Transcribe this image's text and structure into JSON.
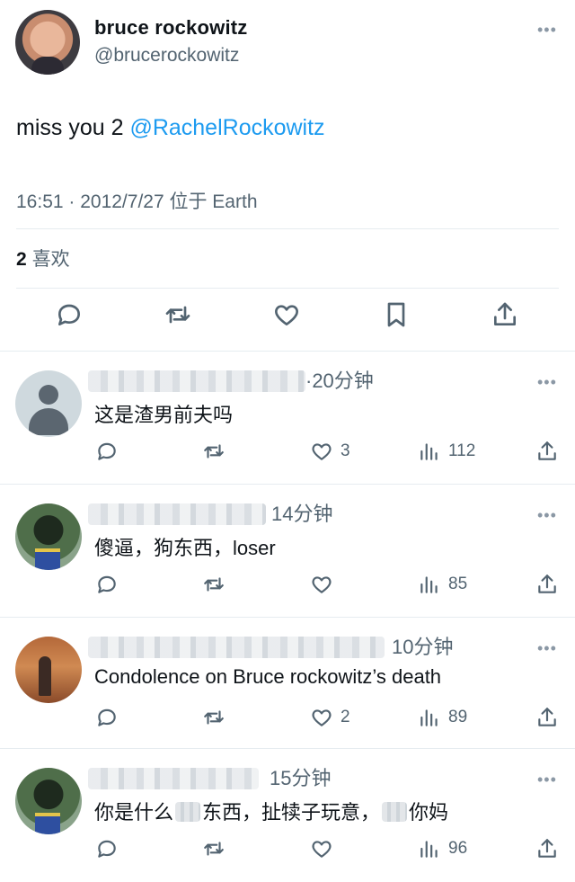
{
  "main_tweet": {
    "name": "bruce rockowitz",
    "handle": "@brucerockowitz",
    "text_prefix": "miss you 2 ",
    "mention": "@RachelRockowitz",
    "meta": "16:51 · 2012/7/27 位于 Earth",
    "likes_count": "2",
    "likes_label": "喜欢",
    "actions": [
      "reply-icon",
      "retweet-icon",
      "like-icon",
      "bookmark-icon",
      "share-icon"
    ]
  },
  "replies": [
    {
      "time": "·20分钟",
      "text": "这是渣男前夫吗",
      "avatar": "default-avatar",
      "likes": "3",
      "views": "112"
    },
    {
      "time": "14分钟",
      "text": "傻逼，狗东西，loser",
      "avatar": "graduate-avatar",
      "likes": "",
      "views": "85"
    },
    {
      "time": "10分钟",
      "text": "Condolence on Bruce rockowitz’s death",
      "avatar": "sunset-avatar",
      "likes": "2",
      "views": "89"
    },
    {
      "time": "15分钟",
      "text_a": "你是什么",
      "text_b": "东西，扯犊子玩意，",
      "text_c": "你妈",
      "avatar": "graduate-avatar",
      "likes": "",
      "views": "96"
    }
  ],
  "colors": {
    "accent": "#1d9bf0",
    "muted": "#536471",
    "divider": "#e6ecf0"
  }
}
